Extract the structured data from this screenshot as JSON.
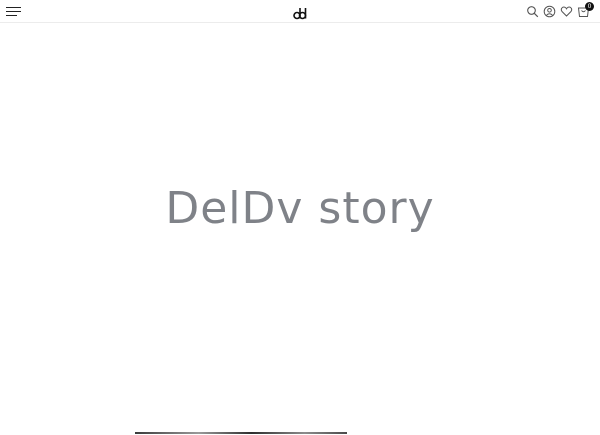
{
  "header": {
    "logo_text": "dd",
    "icons": [
      "menu-icon",
      "search-icon",
      "user-icon",
      "heart-icon",
      "cart-icon"
    ],
    "cart_count": "0"
  },
  "hero": {
    "title": "DelDv story"
  },
  "colors": {
    "title": "#7f8288",
    "icon": "#555555",
    "badge": "#111111"
  }
}
